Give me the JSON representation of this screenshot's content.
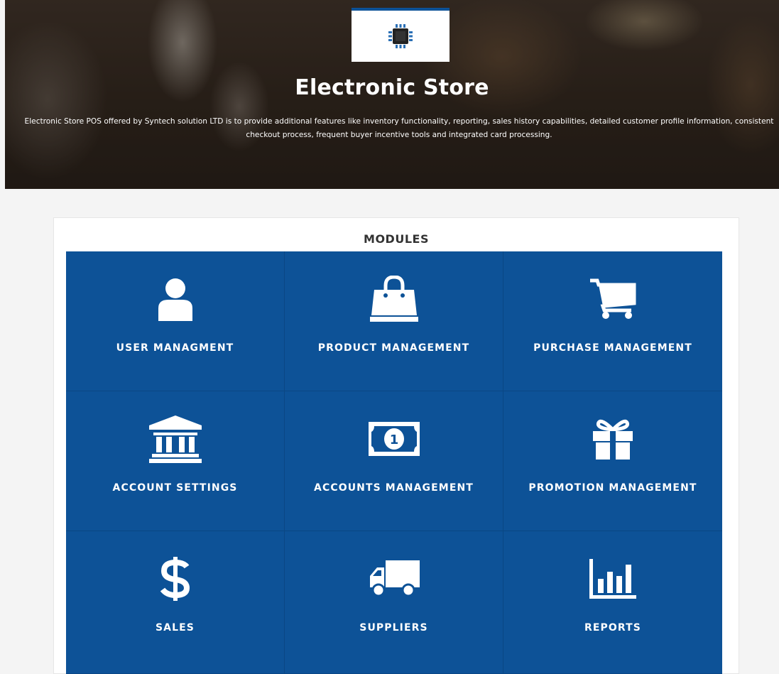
{
  "header": {
    "logo_icon": "chip-icon",
    "title": "Electronic Store",
    "description": "Electronic Store POS offered by Syntech solution LTD is to provide additional features like inventory functionality, reporting, sales history capabilities, detailed customer profile information, consistent checkout process, frequent buyer incentive tools and integrated card processing."
  },
  "modules": {
    "title": "MODULES",
    "tile_color": "#0d5297",
    "items": [
      {
        "label": "USER MANAGMENT",
        "icon": "user-icon"
      },
      {
        "label": "PRODUCT MANAGEMENT",
        "icon": "shopping-bag-icon"
      },
      {
        "label": "PURCHASE MANAGEMENT",
        "icon": "cart-icon"
      },
      {
        "label": "ACCOUNT SETTINGS",
        "icon": "bank-icon"
      },
      {
        "label": "ACCOUNTS MANAGEMENT",
        "icon": "money-icon"
      },
      {
        "label": "PROMOTION MANAGEMENT",
        "icon": "gift-icon"
      },
      {
        "label": "SALES",
        "icon": "dollar-icon"
      },
      {
        "label": "SUPPLIERS",
        "icon": "truck-icon"
      },
      {
        "label": "REPORTS",
        "icon": "bar-chart-icon"
      }
    ]
  }
}
